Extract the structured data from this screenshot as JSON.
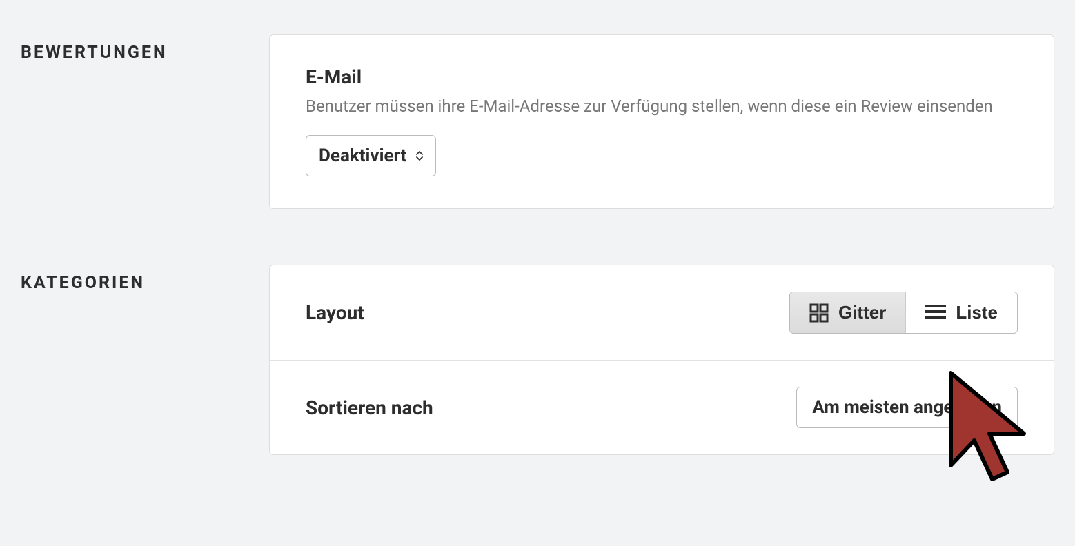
{
  "reviews_section": {
    "label": "BEWERTUNGEN",
    "email": {
      "title": "E-Mail",
      "description": "Benutzer müssen ihre E-Mail-Adresse zur Verfügung stellen, wenn diese ein Review einsenden",
      "selected": "Deaktiviert"
    }
  },
  "categories_section": {
    "label": "KATEGORIEN",
    "layout": {
      "label": "Layout",
      "options": {
        "grid": "Gitter",
        "list": "Liste"
      }
    },
    "sort": {
      "label": "Sortieren nach",
      "selected": "Am meisten angesehen"
    }
  }
}
